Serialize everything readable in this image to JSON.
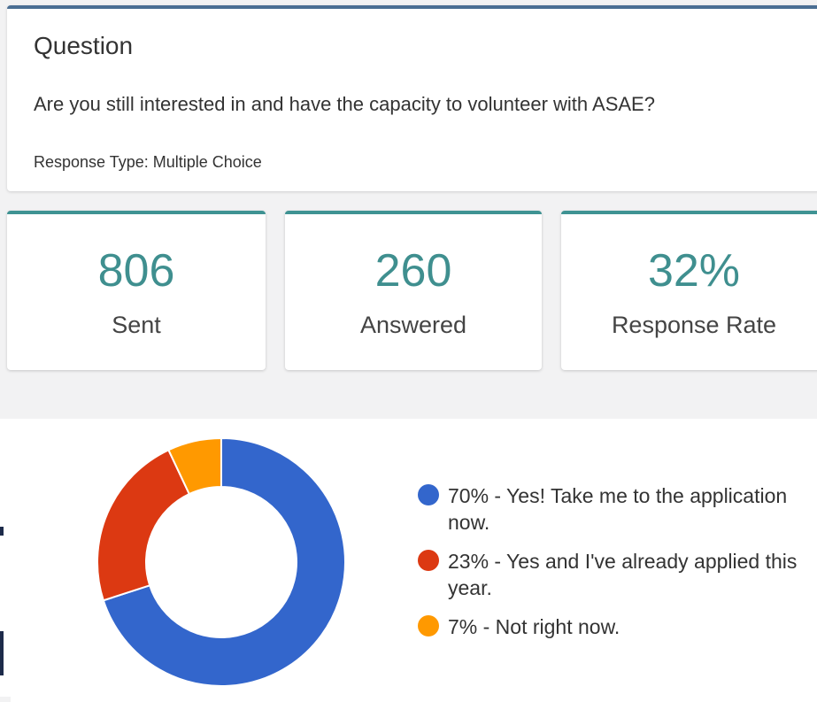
{
  "question": {
    "heading": "Question",
    "text": "Are you still interested in and have the capacity to volunteer with ASAE?",
    "response_type": "Response Type: Multiple Choice"
  },
  "stats": [
    {
      "value": "806",
      "label": "Sent"
    },
    {
      "value": "260",
      "label": "Answered"
    },
    {
      "value": "32%",
      "label": "Response Rate"
    }
  ],
  "colors": {
    "accent_question": "#4a6e93",
    "accent_stats": "#3f9393",
    "stat_value": "#3f8f8f"
  },
  "chart_data": {
    "type": "pie",
    "variant": "donut",
    "slices": [
      {
        "label": "70% - Yes! Take me to the application now.",
        "value": 70,
        "color": "#3366cc"
      },
      {
        "label": "23% - Yes and I've already applied this year.",
        "value": 23,
        "color": "#dc3912"
      },
      {
        "label": "7% - Not right now.",
        "value": 7,
        "color": "#ff9900"
      }
    ],
    "legend_position": "right"
  }
}
